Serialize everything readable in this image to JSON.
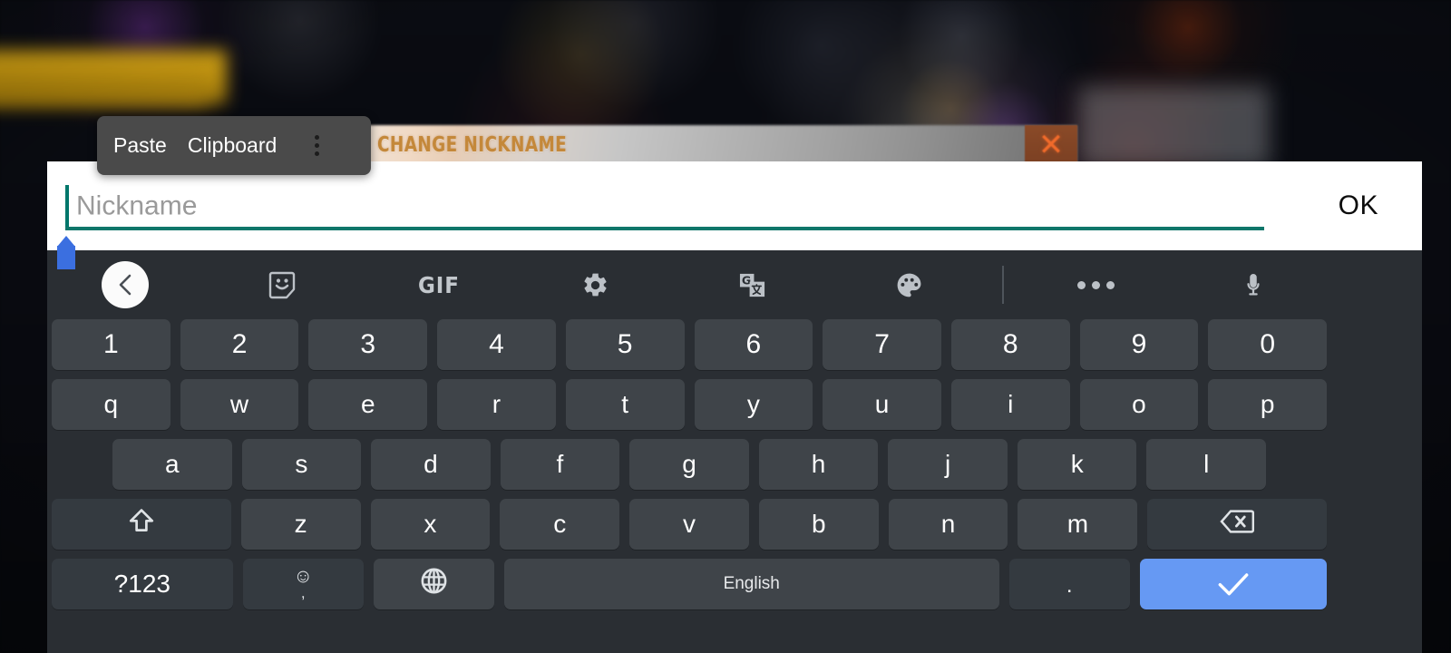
{
  "background": {
    "description": "blurred dark game screen",
    "accent_yellow": "#d8a616",
    "accent_purple": "#8237af"
  },
  "dialog": {
    "title": "CHANGE NICKNAME",
    "title_color": "#c4883a",
    "close_label": "✕",
    "close_bg": "#7b4023",
    "close_color": "#f06a2a"
  },
  "paste_menu": {
    "paste_label": "Paste",
    "clipboard_label": "Clipboard",
    "more_icon": "overflow-menu-icon",
    "background": "#4a4a4a"
  },
  "input": {
    "placeholder": "Nickname",
    "value": "",
    "caret_color": "#00776b",
    "underline_color": "#0f766a",
    "handle_color": "#3b6fe0",
    "ok_label": "OK"
  },
  "keyboard": {
    "background": "#2a2e33",
    "key_bg": "#3f4449",
    "key_dark_bg": "#343a40",
    "enter_bg": "#6699f3",
    "toolbar": [
      {
        "name": "back-button",
        "icon": "chevron-left-icon",
        "label": ""
      },
      {
        "name": "sticker-button",
        "icon": "sticker-icon",
        "label": ""
      },
      {
        "name": "gif-button",
        "icon": "gif-icon",
        "label": "GIF"
      },
      {
        "name": "settings-button",
        "icon": "gear-icon",
        "label": ""
      },
      {
        "name": "translate-button",
        "icon": "translate-icon",
        "label": ""
      },
      {
        "name": "theme-button",
        "icon": "palette-icon",
        "label": ""
      },
      {
        "name": "divider",
        "icon": "divider",
        "label": ""
      },
      {
        "name": "more-button",
        "icon": "overflow-menu-icon",
        "label": ""
      },
      {
        "name": "voice-input-button",
        "icon": "microphone-icon",
        "label": ""
      }
    ],
    "rows": {
      "numbers": [
        "1",
        "2",
        "3",
        "4",
        "5",
        "6",
        "7",
        "8",
        "9",
        "0"
      ],
      "top": [
        "q",
        "w",
        "e",
        "r",
        "t",
        "y",
        "u",
        "i",
        "o",
        "p"
      ],
      "home": [
        "a",
        "s",
        "d",
        "f",
        "g",
        "h",
        "j",
        "k",
        "l"
      ],
      "bottom": [
        "z",
        "x",
        "c",
        "v",
        "b",
        "n",
        "m"
      ],
      "shift_icon": "shift-icon",
      "backspace_icon": "backspace-icon"
    },
    "bottom_row": {
      "symbols_label": "?123",
      "emoji_icon": "emoji-icon",
      "comma_label": ",",
      "globe_icon": "globe-icon",
      "space_label": "English",
      "period_label": ".",
      "enter_icon": "check-icon"
    }
  }
}
